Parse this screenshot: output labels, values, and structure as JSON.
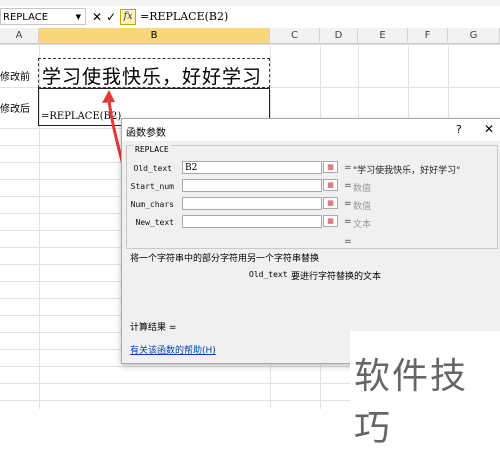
{
  "formula_bar": {
    "name_box": "REPLACE",
    "cancel_icon": "✕",
    "enter_icon": "✓",
    "fx_label": "fx",
    "formula": "=REPLACE(B2)"
  },
  "columns": [
    "A",
    "B",
    "C",
    "D",
    "E",
    "F",
    "G"
  ],
  "selected_column": "B",
  "cells": {
    "a2": "修改前",
    "b2": "学习使我快乐，好好学习",
    "a3": "修改后",
    "b3": "=REPLACE(B2)"
  },
  "annotation": {
    "color": "#e53935"
  },
  "dialog": {
    "title": "函数参数",
    "help_button": "?",
    "close_button": "✕",
    "function_name": "REPLACE",
    "args": [
      {
        "label": "Old_text",
        "value": "B2",
        "result": "\"学习使我快乐，好好学习\""
      },
      {
        "label": "Start_num",
        "value": "",
        "result": "数值"
      },
      {
        "label": "Num_chars",
        "value": "",
        "result": "数值"
      },
      {
        "label": "New_text",
        "value": "",
        "result": "文本"
      }
    ],
    "result_eq": "=",
    "description": "将一个字符串中的部分字符用另一个字符串替换",
    "arg_help_name": "Old_text",
    "arg_help_text": "要进行字符替换的文本",
    "calc_result_label": "计算结果 =",
    "help_link": "有关该函数的帮助(H)"
  },
  "watermark": "软件技巧"
}
